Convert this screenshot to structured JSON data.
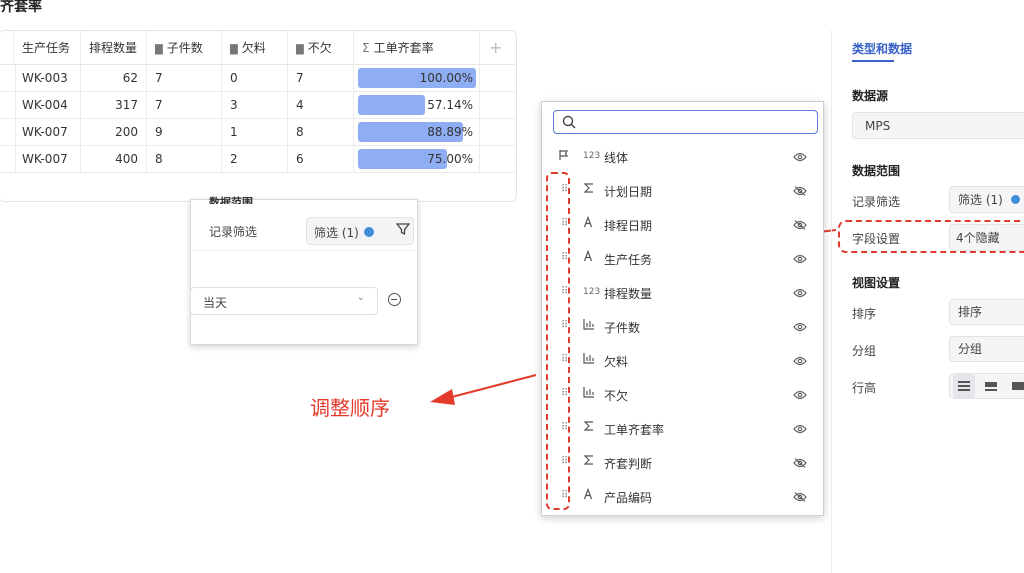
{
  "page_title": "齐套率",
  "table": {
    "columns": [
      {
        "label": "生产任务",
        "icon": ""
      },
      {
        "label": "排程数量",
        "icon": ""
      },
      {
        "label": "子件数",
        "icon": "bar-chart-icon"
      },
      {
        "label": "欠料",
        "icon": "bar-chart-icon"
      },
      {
        "label": "不欠",
        "icon": "bar-chart-icon"
      },
      {
        "label": "工单齐套率",
        "icon": "sigma-icon"
      }
    ],
    "add_column": "+",
    "rows": [
      {
        "task": "WK-003",
        "qty": "62",
        "parts": "7",
        "short": "0",
        "ok": "7",
        "rate": "100.00%",
        "rate_value": 1.0
      },
      {
        "task": "WK-004",
        "qty": "317",
        "parts": "7",
        "short": "3",
        "ok": "4",
        "rate": "57.14%",
        "rate_value": 0.5714
      },
      {
        "task": "WK-007",
        "qty": "200",
        "parts": "9",
        "short": "1",
        "ok": "8",
        "rate": "88.89%",
        "rate_value": 0.8889
      },
      {
        "task": "WK-007",
        "qty": "400",
        "parts": "8",
        "short": "2",
        "ok": "6",
        "rate": "75.00%",
        "rate_value": 0.75
      }
    ],
    "bar_color": "#8fadf2"
  },
  "scope_popup": {
    "heading": "数据范围",
    "record_filter_label": "记录筛选",
    "filter_value": "筛选 (1)",
    "day_select": "当天"
  },
  "annotation": {
    "text": "调整顺序",
    "color": "#e43a2c"
  },
  "field_popup": {
    "search_placeholder": "",
    "fields": [
      {
        "name": "线体",
        "type_icon": "flag-icon",
        "type_text": "123",
        "visible": true,
        "draggable": false
      },
      {
        "name": "计划日期",
        "type_icon": "sigma-icon",
        "type_text": "",
        "visible": false,
        "draggable": true
      },
      {
        "name": "排程日期",
        "type_icon": "text-a-icon",
        "type_text": "",
        "visible": false,
        "draggable": true
      },
      {
        "name": "生产任务",
        "type_icon": "text-a-icon",
        "type_text": "",
        "visible": true,
        "draggable": true
      },
      {
        "name": "排程数量",
        "type_icon": "number-icon",
        "type_text": "123",
        "visible": true,
        "draggable": true
      },
      {
        "name": "子件数",
        "type_icon": "bar-chart-icon",
        "type_text": "",
        "visible": true,
        "draggable": true
      },
      {
        "name": "欠料",
        "type_icon": "bar-chart-icon",
        "type_text": "",
        "visible": true,
        "draggable": true
      },
      {
        "name": "不欠",
        "type_icon": "bar-chart-icon",
        "type_text": "",
        "visible": true,
        "draggable": true
      },
      {
        "name": "工单齐套率",
        "type_icon": "sigma-icon",
        "type_text": "",
        "visible": true,
        "draggable": true
      },
      {
        "name": "齐套判断",
        "type_icon": "sigma-icon",
        "type_text": "",
        "visible": false,
        "draggable": true
      },
      {
        "name": "产品编码",
        "type_icon": "text-a-icon",
        "type_text": "",
        "visible": false,
        "draggable": true
      }
    ]
  },
  "right_panel": {
    "tab": "类型和数据",
    "data_source_title": "数据源",
    "data_source_value": "MPS",
    "scope_title": "数据范围",
    "record_filter_label": "记录筛选",
    "record_filter_value": "筛选 (1)",
    "field_settings_label": "字段设置",
    "field_settings_value": "4个隐藏",
    "view_settings_title": "视图设置",
    "sort_label": "排序",
    "sort_value": "排序",
    "group_label": "分组",
    "group_value": "分组",
    "row_height_label": "行高"
  },
  "accent_color": "#3a62c9",
  "highlight_color": "#e03a2e"
}
